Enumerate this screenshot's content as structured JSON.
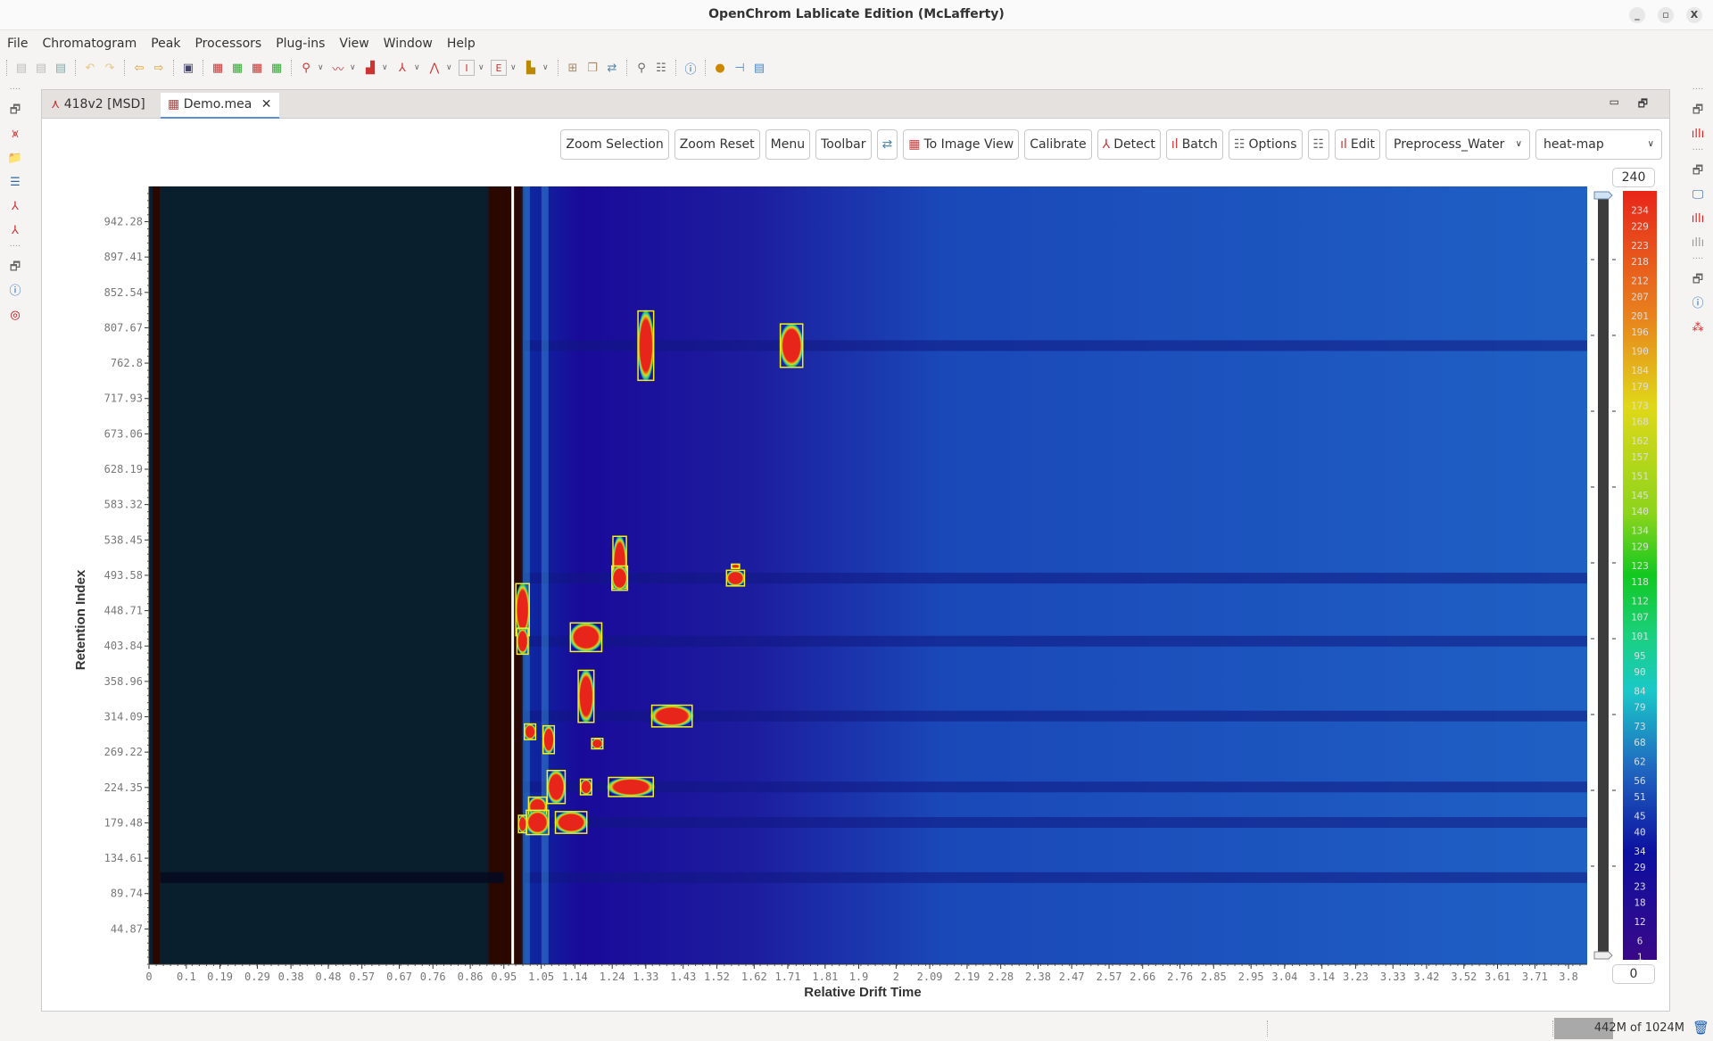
{
  "window": {
    "title": "OpenChrom Lablicate Edition (McLafferty)",
    "buttons": [
      "_",
      "▫",
      "X"
    ]
  },
  "menu": [
    "File",
    "Chromatogram",
    "Peak",
    "Processors",
    "Plug-ins",
    "View",
    "Window",
    "Help"
  ],
  "toolbar_icons": [
    "save-icon",
    "save-as-icon",
    "save-all-icon",
    "undo-icon",
    "redo-icon",
    "back-icon",
    "forward-icon",
    "camera-icon",
    "import-chromatogram-icon",
    "add-chromatogram-icon",
    "add-chromatogram-red-icon",
    "add-chromatogram-green-icon",
    "peak-zoom-icon",
    "baseline-icon",
    "peak-detector-icon",
    "peak-icon",
    "peaks-icon",
    "integrator-icon",
    "export-icon",
    "library-icon",
    "new-perspective-icon",
    "new-window-icon",
    "switch-icon",
    "search-icon",
    "settings-list-icon",
    "info-icon",
    "user-icon",
    "plugin-icon",
    "report-icon"
  ],
  "tabs": [
    {
      "label": "418v2 [MSD]",
      "icon": "chromatogram-icon",
      "active": false
    },
    {
      "label": "Demo.mea",
      "icon": "ims-icon",
      "active": true,
      "closable": true
    }
  ],
  "editor_buttons": {
    "zoom_selection": "Zoom Selection",
    "zoom_reset": "Zoom Reset",
    "menu": "Menu",
    "toolbar": "Toolbar",
    "to_image_view": "To Image View",
    "calibrate": "Calibrate",
    "detect": "Detect",
    "batch": "Batch",
    "options": "Options",
    "edit": "Edit"
  },
  "selects": {
    "preprocess": "Preprocess_Water",
    "colormap": "heat-map"
  },
  "chart_data": {
    "type": "heatmap",
    "xlabel": "Relative Drift Time",
    "ylabel": "Retention Index",
    "x_ticks": [
      "0",
      "0.1",
      "0.19",
      "0.29",
      "0.38",
      "0.48",
      "0.57",
      "0.67",
      "0.76",
      "0.86",
      "0.95",
      "1.05",
      "1.14",
      "1.24",
      "1.33",
      "1.43",
      "1.52",
      "1.62",
      "1.71",
      "1.81",
      "1.9",
      "2",
      "2.09",
      "2.19",
      "2.28",
      "2.38",
      "2.47",
      "2.57",
      "2.66",
      "2.76",
      "2.85",
      "2.95",
      "3.04",
      "3.14",
      "3.23",
      "3.33",
      "3.42",
      "3.52",
      "3.61",
      "3.71",
      "3.8"
    ],
    "y_ticks": [
      "44.87",
      "89.74",
      "134.61",
      "179.48",
      "224.35",
      "269.22",
      "314.09",
      "358.96",
      "403.84",
      "448.71",
      "493.58",
      "538.45",
      "583.32",
      "628.19",
      "673.06",
      "717.93",
      "762.8",
      "807.67",
      "852.54",
      "897.41",
      "942.28"
    ],
    "xlim": [
      0,
      3.85
    ],
    "ylim": [
      0,
      987
    ],
    "color_scale": {
      "max": 240,
      "min": 0,
      "labels": [
        "234",
        "229",
        "223",
        "218",
        "212",
        "207",
        "201",
        "196",
        "190",
        "184",
        "179",
        "173",
        "168",
        "162",
        "157",
        "151",
        "145",
        "140",
        "134",
        "129",
        "123",
        "118",
        "112",
        "107",
        "101",
        "95",
        "90",
        "84",
        "79",
        "73",
        "68",
        "62",
        "56",
        "51",
        "45",
        "40",
        "34",
        "29",
        "23",
        "18",
        "12",
        "6",
        "1"
      ]
    },
    "peaks": [
      {
        "x": 1.33,
        "y": 785,
        "w": 0.035,
        "h": 80
      },
      {
        "x": 1.72,
        "y": 785,
        "w": 0.05,
        "h": 50
      },
      {
        "x": 1.26,
        "y": 510,
        "w": 0.03,
        "h": 60
      },
      {
        "x": 1.26,
        "y": 490,
        "w": 0.035,
        "h": 28
      },
      {
        "x": 1.57,
        "y": 490,
        "w": 0.04,
        "h": 18
      },
      {
        "x": 1.57,
        "y": 505,
        "w": 0.018,
        "h": 5
      },
      {
        "x": 1.0,
        "y": 450,
        "w": 0.03,
        "h": 60
      },
      {
        "x": 1.0,
        "y": 410,
        "w": 0.025,
        "h": 30
      },
      {
        "x": 1.17,
        "y": 415,
        "w": 0.07,
        "h": 33
      },
      {
        "x": 1.17,
        "y": 340,
        "w": 0.035,
        "h": 60
      },
      {
        "x": 1.4,
        "y": 315,
        "w": 0.09,
        "h": 25
      },
      {
        "x": 1.02,
        "y": 295,
        "w": 0.025,
        "h": 18
      },
      {
        "x": 1.07,
        "y": 285,
        "w": 0.025,
        "h": 32
      },
      {
        "x": 1.2,
        "y": 280,
        "w": 0.025,
        "h": 12
      },
      {
        "x": 1.09,
        "y": 225,
        "w": 0.04,
        "h": 38
      },
      {
        "x": 1.29,
        "y": 225,
        "w": 0.1,
        "h": 22
      },
      {
        "x": 1.17,
        "y": 225,
        "w": 0.025,
        "h": 18
      },
      {
        "x": 1.04,
        "y": 200,
        "w": 0.04,
        "h": 22
      },
      {
        "x": 1.04,
        "y": 180,
        "w": 0.05,
        "h": 28
      },
      {
        "x": 1.13,
        "y": 180,
        "w": 0.07,
        "h": 25
      },
      {
        "x": 1.0,
        "y": 178,
        "w": 0.018,
        "h": 20
      }
    ]
  },
  "status": {
    "memory": "442M of 1024M",
    "memory_used_fraction": 0.43
  }
}
